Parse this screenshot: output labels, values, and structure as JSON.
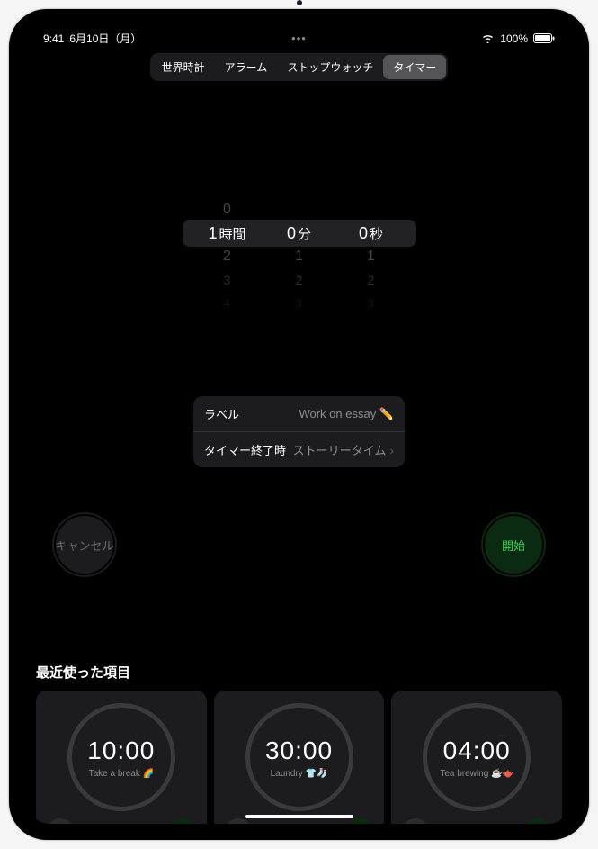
{
  "status": {
    "time": "9:41",
    "date": "6月10日（月）",
    "battery": "100%"
  },
  "tabs": [
    {
      "label": "世界時計"
    },
    {
      "label": "アラーム"
    },
    {
      "label": "ストップウォッチ"
    },
    {
      "label": "タイマー"
    }
  ],
  "picker": {
    "hours": {
      "prev": "0",
      "sel": "1",
      "unit": "時間",
      "n1": "2",
      "n2": "3",
      "n3": "4"
    },
    "minutes": {
      "prev": "",
      "sel": "0",
      "unit": "分",
      "n1": "1",
      "n2": "2",
      "n3": "3"
    },
    "seconds": {
      "prev": "",
      "sel": "0",
      "unit": "秒",
      "n1": "1",
      "n2": "2",
      "n3": "3"
    }
  },
  "settings": {
    "label_label": "ラベル",
    "label_value": "Work on essay ✏️",
    "end_label": "タイマー終了時",
    "end_value": "ストーリータイム"
  },
  "buttons": {
    "cancel": "キャンセル",
    "start": "開始"
  },
  "recent": {
    "title": "最近使った項目",
    "items": [
      {
        "time": "10:00",
        "label": "Take a break 🌈"
      },
      {
        "time": "30:00",
        "label": "Laundry 👕🧦"
      },
      {
        "time": "04:00",
        "label": "Tea brewing ☕️🫖"
      }
    ]
  }
}
